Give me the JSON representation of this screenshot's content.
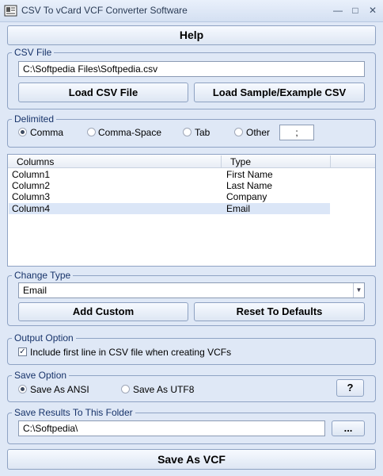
{
  "window": {
    "title": "CSV To vCard VCF Converter Software"
  },
  "help_label": "Help",
  "csv_file": {
    "legend": "CSV File",
    "path": "C:\\Softpedia Files\\Softpedia.csv",
    "load_label": "Load CSV File",
    "load_sample_label": "Load Sample/Example CSV"
  },
  "delimited": {
    "legend": "Delimited",
    "options": [
      "Comma",
      "Comma-Space",
      "Tab",
      "Other"
    ],
    "selected": "Comma",
    "other_value": ";"
  },
  "columns_table": {
    "headers": [
      "Columns",
      "Type"
    ],
    "rows": [
      {
        "column": "Column1",
        "type": "First Name"
      },
      {
        "column": "Column2",
        "type": "Last Name"
      },
      {
        "column": "Column3",
        "type": "Company"
      },
      {
        "column": "Column4",
        "type": "Email"
      }
    ],
    "selected_row": 3
  },
  "change_type": {
    "legend": "Change Type",
    "value": "Email",
    "add_custom_label": "Add Custom",
    "reset_label": "Reset To Defaults"
  },
  "output_option": {
    "legend": "Output Option",
    "include_first_line_label": "Include first line in CSV file when creating VCFs",
    "include_first_line_checked": true
  },
  "save_option": {
    "legend": "Save Option",
    "ansi_label": "Save As ANSI",
    "utf8_label": "Save As UTF8",
    "selected": "ANSI",
    "help_label": "?"
  },
  "save_folder": {
    "legend": "Save Results To This Folder",
    "path": "C:\\Softpedia\\",
    "browse_label": "..."
  },
  "save_vcf_label": "Save As VCF",
  "icons": {
    "app": "vcard-app-icon",
    "minimize": "minimize-icon",
    "maximize": "maximize-icon",
    "close": "close-icon",
    "dropdown": "chevron-down-icon"
  }
}
